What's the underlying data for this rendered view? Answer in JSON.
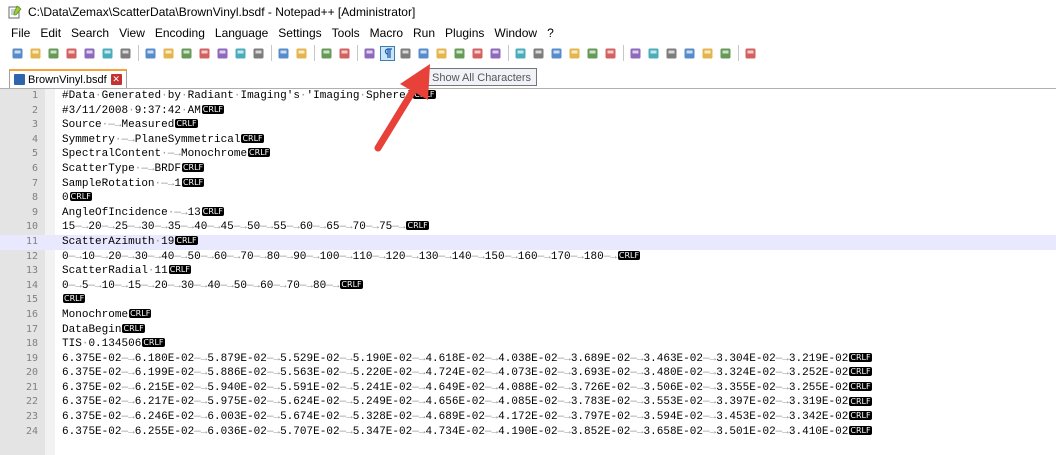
{
  "window": {
    "title": "C:\\Data\\Zemax\\ScatterData\\BrownVinyl.bsdf - Notepad++ [Administrator]"
  },
  "menu": [
    "File",
    "Edit",
    "Search",
    "View",
    "Encoding",
    "Language",
    "Settings",
    "Tools",
    "Macro",
    "Run",
    "Plugins",
    "Window",
    "?"
  ],
  "toolbar": {
    "tooltip": "Show All Characters",
    "icons": [
      "new-file",
      "open-file",
      "save",
      "save-all",
      "close",
      "close-all",
      "print",
      "cut",
      "copy",
      "paste",
      "undo",
      "redo",
      "find",
      "replace",
      "zoom-in",
      "zoom-out",
      "sync-vertical",
      "sync-horizontal",
      "word-wrap",
      "show-all-characters",
      "indent-guide",
      "user-defined-language",
      "document-map",
      "function-list",
      "folder-as-workspace",
      "monitoring",
      "record-macro",
      "stop-recording",
      "playback-macro",
      "run-macro-multiple",
      "save-macro",
      "launch-in-browser-1",
      "launch-in-browser-2",
      "launch-in-browser-3",
      "sort-1",
      "up",
      "down",
      "sort-2",
      "settings"
    ]
  },
  "tab": {
    "label": "BrownVinyl.bsdf"
  },
  "editor": {
    "current_line": 11,
    "crlf_label": "CRLF",
    "lines": [
      {
        "n": "1",
        "text": "#Data·Generated·by·Radiant·Imaging's·'Imaging·Sphere'"
      },
      {
        "n": "2",
        "text": "#3/11/2008·9:37:42·AM"
      },
      {
        "n": "3",
        "text": "Source·→Measured"
      },
      {
        "n": "4",
        "text": "Symmetry·→PlaneSymmetrical"
      },
      {
        "n": "5",
        "text": "SpectralContent·→Monochrome"
      },
      {
        "n": "6",
        "text": "ScatterType·→BRDF"
      },
      {
        "n": "7",
        "text": "SampleRotation·→1"
      },
      {
        "n": "8",
        "text": "0"
      },
      {
        "n": "9",
        "text": "AngleOfIncidence·→13"
      },
      {
        "n": "10",
        "text": "15→20→25→30→35→40→45→50→55→60→65→70→75→"
      },
      {
        "n": "11",
        "text": "ScatterAzimuth·19"
      },
      {
        "n": "12",
        "text": "0→10→20→30→40→50→60→70→80→90→100→110→120→130→140→150→160→170→180→"
      },
      {
        "n": "13",
        "text": "ScatterRadial·11"
      },
      {
        "n": "14",
        "text": "0→5→10→15→20→30→40→50→60→70→80→"
      },
      {
        "n": "15",
        "text": ""
      },
      {
        "n": "16",
        "text": "Monochrome"
      },
      {
        "n": "17",
        "text": "DataBegin"
      },
      {
        "n": "18",
        "text": "TIS·0.134506"
      },
      {
        "n": "19",
        "text": "6.375E-02→6.180E-02→5.879E-02→5.529E-02→5.190E-02→4.618E-02→4.038E-02→3.689E-02→3.463E-02→3.304E-02→3.219E-02"
      },
      {
        "n": "20",
        "text": "6.375E-02→6.199E-02→5.886E-02→5.563E-02→5.220E-02→4.724E-02→4.073E-02→3.693E-02→3.480E-02→3.324E-02→3.252E-02"
      },
      {
        "n": "21",
        "text": "6.375E-02→6.215E-02→5.940E-02→5.591E-02→5.241E-02→4.649E-02→4.088E-02→3.726E-02→3.506E-02→3.355E-02→3.255E-02"
      },
      {
        "n": "22",
        "text": "6.375E-02→6.217E-02→5.975E-02→5.624E-02→5.249E-02→4.656E-02→4.085E-02→3.783E-02→3.553E-02→3.397E-02→3.319E-02"
      },
      {
        "n": "23",
        "text": "6.375E-02→6.246E-02→6.003E-02→5.674E-02→5.328E-02→4.689E-02→4.172E-02→3.797E-02→3.594E-02→3.453E-02→3.342E-02"
      },
      {
        "n": "24",
        "text": "6.375E-02→6.255E-02→6.036E-02→5.707E-02→5.347E-02→4.734E-02→4.190E-02→3.852E-02→3.658E-02→3.501E-02→3.410E-02"
      }
    ]
  },
  "colors": {
    "current_line_bg": "#e8e8ff",
    "annotation_arrow": "#e8413a",
    "tab_accent": "#f9a13a"
  }
}
